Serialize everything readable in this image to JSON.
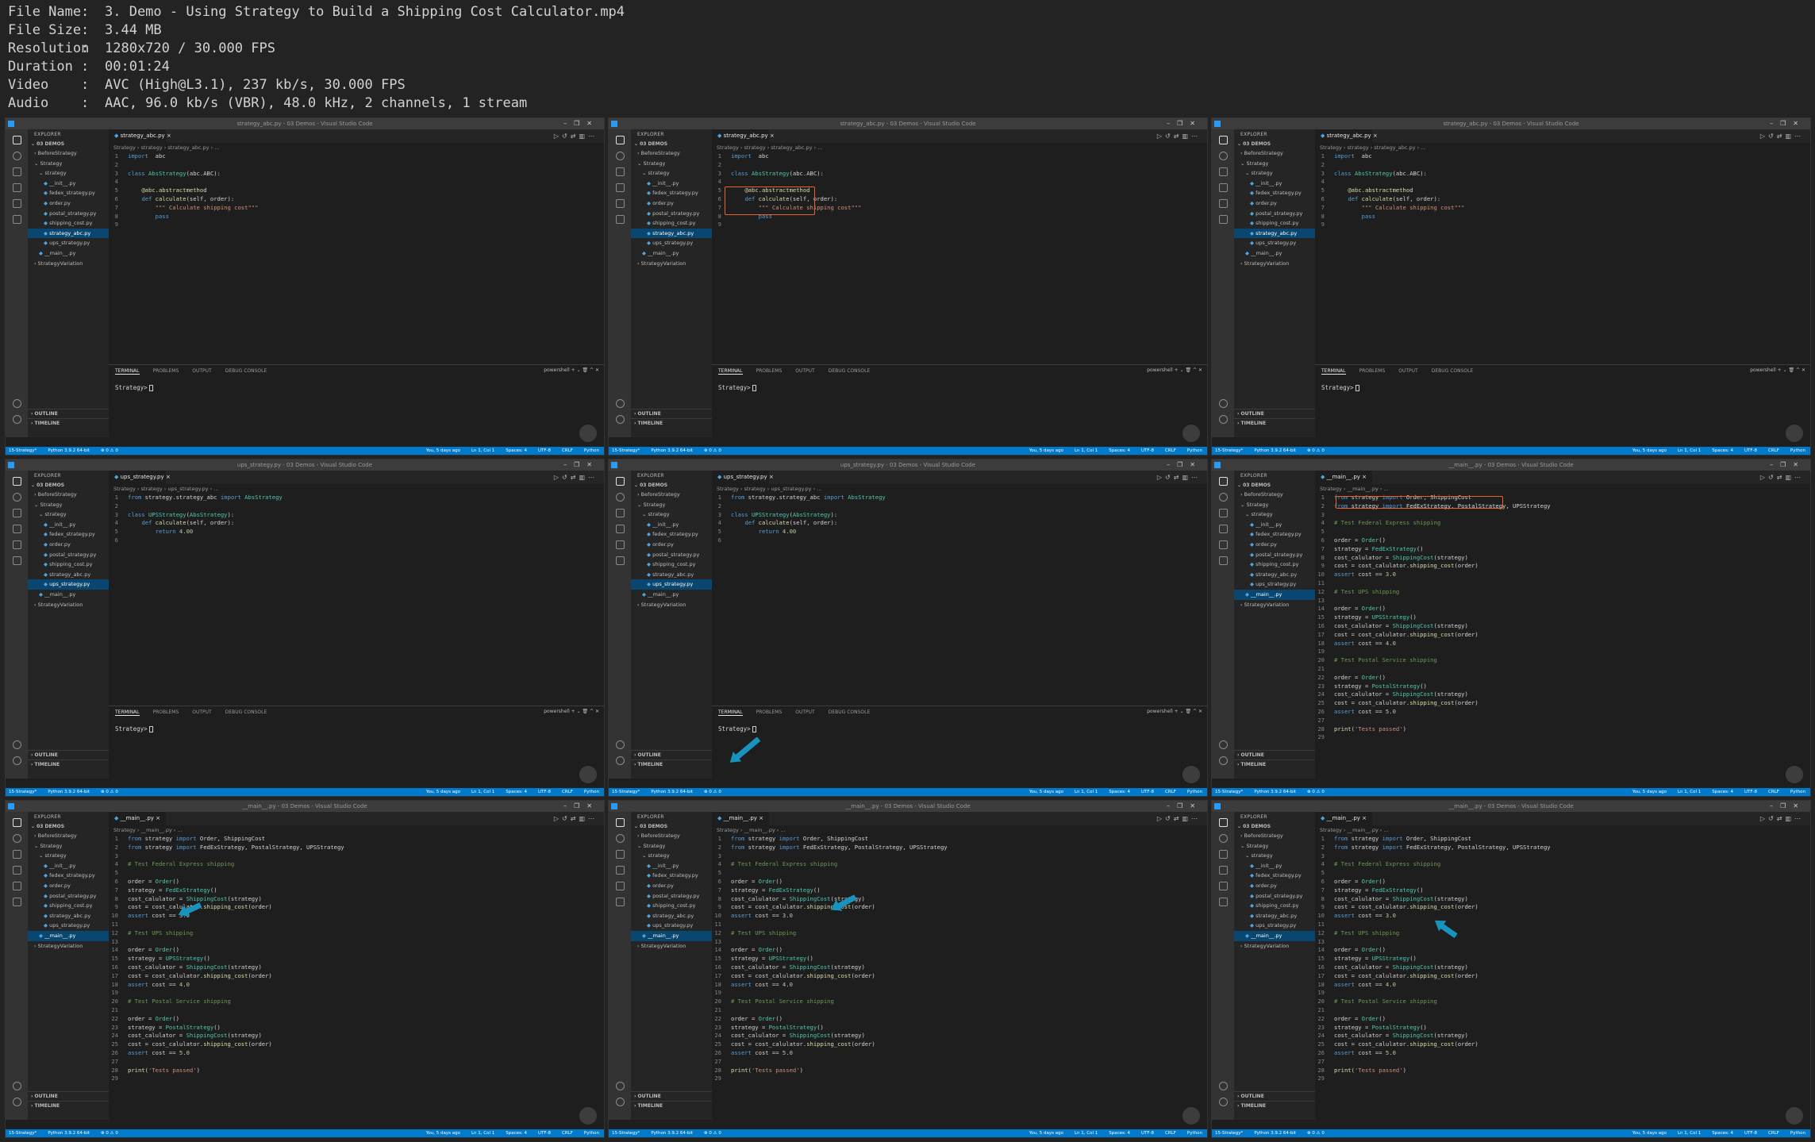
{
  "info": {
    "rows": [
      {
        "label": "File Name",
        "value": "3. Demo - Using Strategy to Build a Shipping Cost Calculator.mp4"
      },
      {
        "label": "File Size",
        "value": "3.44 MB"
      },
      {
        "label": "Resolution",
        "value": "1280x720 / 30.000 FPS"
      },
      {
        "label": "Duration",
        "value": "00:01:24"
      },
      {
        "label": "Video",
        "value": "AVC (High@L3.1), 237 kb/s, 30.000 FPS"
      },
      {
        "label": "Audio",
        "value": "AAC, 96.0 kb/s (VBR), 48.0 kHz, 2 channels, 1 stream"
      }
    ]
  },
  "common": {
    "explorer_title": "EXPLORER",
    "root_folder": "03 DEMOS",
    "outline": "OUTLINE",
    "timeline": "TIMELINE",
    "terminal_tabs": [
      "TERMINAL",
      "PROBLEMS",
      "OUTPUT",
      "DEBUG CONSOLE"
    ],
    "terminal_shell": "powershell",
    "prompt": "Strategy>",
    "status_left": [
      "15-Strategy*",
      "Python 3.9.2 64-bit",
      "⊗ 0 ⚠ 0"
    ],
    "status_right": [
      "You, 5 days ago",
      "Ln 1, Col 1",
      "Spaces: 4",
      "UTF-8",
      "CRLF",
      "Python"
    ],
    "colors": {
      "accent": "#007acc",
      "highlight_box": "#e8612c",
      "arrow": "#1893bd",
      "selection": "#094771"
    }
  },
  "trees": {
    "abc": [
      {
        "label": "BeforeStrategy",
        "indent": 1,
        "kind": "folder"
      },
      {
        "label": "Strategy",
        "indent": 1,
        "kind": "folder-open"
      },
      {
        "label": "strategy",
        "indent": 2,
        "kind": "folder-open"
      },
      {
        "label": "__init__.py",
        "indent": 3,
        "kind": "py"
      },
      {
        "label": "fedex_strategy.py",
        "indent": 3,
        "kind": "py"
      },
      {
        "label": "order.py",
        "indent": 3,
        "kind": "py"
      },
      {
        "label": "postal_strategy.py",
        "indent": 3,
        "kind": "py"
      },
      {
        "label": "shipping_cost.py",
        "indent": 3,
        "kind": "py"
      },
      {
        "label": "strategy_abc.py",
        "indent": 3,
        "kind": "py",
        "selected": true
      },
      {
        "label": "ups_strategy.py",
        "indent": 3,
        "kind": "py"
      },
      {
        "label": "__main__.py",
        "indent": 2,
        "kind": "py"
      },
      {
        "label": "StrategyVariation",
        "indent": 1,
        "kind": "folder"
      }
    ],
    "ups": [
      {
        "label": "BeforeStrategy",
        "indent": 1,
        "kind": "folder"
      },
      {
        "label": "Strategy",
        "indent": 1,
        "kind": "folder-open"
      },
      {
        "label": "strategy",
        "indent": 2,
        "kind": "folder-open"
      },
      {
        "label": "__init__.py",
        "indent": 3,
        "kind": "py"
      },
      {
        "label": "fedex_strategy.py",
        "indent": 3,
        "kind": "py"
      },
      {
        "label": "order.py",
        "indent": 3,
        "kind": "py"
      },
      {
        "label": "postal_strategy.py",
        "indent": 3,
        "kind": "py"
      },
      {
        "label": "shipping_cost.py",
        "indent": 3,
        "kind": "py"
      },
      {
        "label": "strategy_abc.py",
        "indent": 3,
        "kind": "py"
      },
      {
        "label": "ups_strategy.py",
        "indent": 3,
        "kind": "py",
        "selected": true
      },
      {
        "label": "__main__.py",
        "indent": 2,
        "kind": "py"
      },
      {
        "label": "StrategyVariation",
        "indent": 1,
        "kind": "folder"
      }
    ],
    "main": [
      {
        "label": "BeforeStrategy",
        "indent": 1,
        "kind": "folder"
      },
      {
        "label": "Strategy",
        "indent": 1,
        "kind": "folder-open"
      },
      {
        "label": "strategy",
        "indent": 2,
        "kind": "folder-open"
      },
      {
        "label": "__init__.py",
        "indent": 3,
        "kind": "py"
      },
      {
        "label": "fedex_strategy.py",
        "indent": 3,
        "kind": "py"
      },
      {
        "label": "order.py",
        "indent": 3,
        "kind": "py"
      },
      {
        "label": "postal_strategy.py",
        "indent": 3,
        "kind": "py"
      },
      {
        "label": "shipping_cost.py",
        "indent": 3,
        "kind": "py"
      },
      {
        "label": "strategy_abc.py",
        "indent": 3,
        "kind": "py"
      },
      {
        "label": "ups_strategy.py",
        "indent": 3,
        "kind": "py"
      },
      {
        "label": "__main__.py",
        "indent": 2,
        "kind": "py",
        "selected": true
      },
      {
        "label": "StrategyVariation",
        "indent": 1,
        "kind": "folder"
      }
    ]
  },
  "codes": {
    "abc": [
      [
        [
          "k",
          "import"
        ],
        [
          "",
          "  abc"
        ]
      ],
      [],
      [
        [
          "k",
          "class"
        ],
        [
          "",
          " "
        ],
        [
          "cls",
          "AbsStrategy"
        ],
        [
          "",
          "(abc.ABC):"
        ]
      ],
      [],
      [
        [
          "",
          "    "
        ],
        [
          "fn",
          "@abc.abstractmethod"
        ]
      ],
      [
        [
          "",
          "    "
        ],
        [
          "k",
          "def"
        ],
        [
          "",
          " "
        ],
        [
          "fn",
          "calculate"
        ],
        [
          "",
          "(self, order):"
        ]
      ],
      [
        [
          "",
          "        "
        ],
        [
          "st",
          "\"\"\" Calculate shipping cost\"\"\""
        ]
      ],
      [
        [
          "",
          "        "
        ],
        [
          "k",
          "pass"
        ]
      ],
      []
    ],
    "ups": [
      [
        [
          "k",
          "from"
        ],
        [
          "",
          " strategy.strategy_abc "
        ],
        [
          "k",
          "import"
        ],
        [
          "",
          " "
        ],
        [
          "cls",
          "AbsStrategy"
        ]
      ],
      [],
      [
        [
          "k",
          "class"
        ],
        [
          "",
          " "
        ],
        [
          "cls",
          "UPSStrategy"
        ],
        [
          "",
          "("
        ],
        [
          "cls",
          "AbsStrategy"
        ],
        [
          "",
          "):"
        ]
      ],
      [
        [
          "",
          "    "
        ],
        [
          "k",
          "def"
        ],
        [
          "",
          " "
        ],
        [
          "fn",
          "calculate"
        ],
        [
          "",
          "(self, order):"
        ]
      ],
      [
        [
          "",
          "        "
        ],
        [
          "k",
          "return"
        ],
        [
          "",
          " "
        ],
        [
          "nu",
          "4.00"
        ]
      ],
      []
    ],
    "main": [
      [
        [
          "k",
          "from"
        ],
        [
          "",
          " strategy "
        ],
        [
          "k",
          "import"
        ],
        [
          "",
          " Order, ShippingCost"
        ]
      ],
      [
        [
          "k",
          "from"
        ],
        [
          "",
          " strategy "
        ],
        [
          "k",
          "import"
        ],
        [
          "",
          " FedExStrategy, PostalStrategy, UPSStrategy"
        ]
      ],
      [],
      [
        [
          "cm",
          "# Test Federal Express shipping"
        ]
      ],
      [],
      [
        [
          "",
          "order = "
        ],
        [
          "cls",
          "Order"
        ],
        [
          "",
          "()"
        ]
      ],
      [
        [
          "",
          "strategy = "
        ],
        [
          "cls",
          "FedExStrategy"
        ],
        [
          "",
          "()"
        ]
      ],
      [
        [
          "",
          "cost_calulator = "
        ],
        [
          "cls",
          "ShippingCost"
        ],
        [
          "",
          "(strategy)"
        ]
      ],
      [
        [
          "",
          "cost = cost_calulator."
        ],
        [
          "fn",
          "shipping_cost"
        ],
        [
          "",
          "(order)"
        ]
      ],
      [
        [
          "k",
          "assert"
        ],
        [
          "",
          " cost == "
        ],
        [
          "nu",
          "3.0"
        ]
      ],
      [],
      [
        [
          "cm",
          "# Test UPS shipping"
        ]
      ],
      [],
      [
        [
          "",
          "order = "
        ],
        [
          "cls",
          "Order"
        ],
        [
          "",
          "()"
        ]
      ],
      [
        [
          "",
          "strategy = "
        ],
        [
          "cls",
          "UPSStrategy"
        ],
        [
          "",
          "()"
        ]
      ],
      [
        [
          "",
          "cost_calulator = "
        ],
        [
          "cls",
          "ShippingCost"
        ],
        [
          "",
          "(strategy)"
        ]
      ],
      [
        [
          "",
          "cost = cost_calulator."
        ],
        [
          "fn",
          "shipping_cost"
        ],
        [
          "",
          "(order)"
        ]
      ],
      [
        [
          "k",
          "assert"
        ],
        [
          "",
          " cost == "
        ],
        [
          "nu",
          "4.0"
        ]
      ],
      [],
      [
        [
          "cm",
          "# Test Postal Service shipping"
        ]
      ],
      [],
      [
        [
          "",
          "order = "
        ],
        [
          "cls",
          "Order"
        ],
        [
          "",
          "()"
        ]
      ],
      [
        [
          "",
          "strategy = "
        ],
        [
          "cls",
          "PostalStrategy"
        ],
        [
          "",
          "()"
        ]
      ],
      [
        [
          "",
          "cost_calulator = "
        ],
        [
          "cls",
          "ShippingCost"
        ],
        [
          "",
          "(strategy)"
        ]
      ],
      [
        [
          "",
          "cost = cost_calulator."
        ],
        [
          "fn",
          "shipping_cost"
        ],
        [
          "",
          "(order)"
        ]
      ],
      [
        [
          "k",
          "assert"
        ],
        [
          "",
          " cost == "
        ],
        [
          "nu",
          "5.0"
        ]
      ],
      [],
      [
        [
          "fn",
          "print"
        ],
        [
          "",
          "("
        ],
        [
          "st",
          "'Tests passed'"
        ],
        [
          "",
          ")"
        ]
      ],
      []
    ]
  },
  "frames": [
    {
      "title": "strategy_abc.py - 03 Demos - Visual Studio Code",
      "tab": "strategy_abc.py",
      "breadcrumb": "Strategy  ›  strategy  ›  strategy_abc.py  ›  ...",
      "code": "abc",
      "tree": "abc",
      "terminal": true
    },
    {
      "title": "strategy_abc.py - 03 Demos - Visual Studio Code",
      "tab": "strategy_abc.py",
      "breadcrumb": "Strategy  ›  strategy  ›  strategy_abc.py  ›  ...",
      "code": "abc",
      "tree": "abc",
      "terminal": true
    },
    {
      "title": "strategy_abc.py - 03 Demos - Visual Studio Code",
      "tab": "strategy_abc.py",
      "breadcrumb": "Strategy  ›  strategy  ›  strategy_abc.py  ›  ...",
      "code": "abc",
      "tree": "abc",
      "terminal": true
    },
    {
      "title": "ups_strategy.py - 03 Demos - Visual Studio Code",
      "tab": "ups_strategy.py",
      "breadcrumb": "Strategy  ›  strategy  ›  ups_strategy.py  ›  ...",
      "code": "ups",
      "tree": "ups",
      "terminal": true
    },
    {
      "title": "ups_strategy.py - 03 Demos - Visual Studio Code",
      "tab": "ups_strategy.py",
      "breadcrumb": "Strategy  ›  strategy  ›  ups_strategy.py  ›  ...",
      "code": "ups",
      "tree": "ups",
      "terminal": true
    },
    {
      "title": "__main__.py - 03 Demos - Visual Studio Code",
      "tab": "__main__.py",
      "breadcrumb": "Strategy  ›  __main__.py  ›  ...",
      "code": "main",
      "tree": "main",
      "terminal": false
    },
    {
      "title": "__main__.py - 03 Demos - Visual Studio Code",
      "tab": "__main__.py",
      "breadcrumb": "Strategy  ›  __main__.py  ›  ...",
      "code": "main",
      "tree": "main",
      "terminal": false
    },
    {
      "title": "__main__.py - 03 Demos - Visual Studio Code",
      "tab": "__main__.py",
      "breadcrumb": "Strategy  ›  __main__.py  ›  ...",
      "code": "main",
      "tree": "main",
      "terminal": false
    },
    {
      "title": "__main__.py - 03 Demos - Visual Studio Code",
      "tab": "__main__.py",
      "breadcrumb": "Strategy  ›  __main__.py  ›  ...",
      "code": "main",
      "tree": "main",
      "terminal": false
    }
  ]
}
